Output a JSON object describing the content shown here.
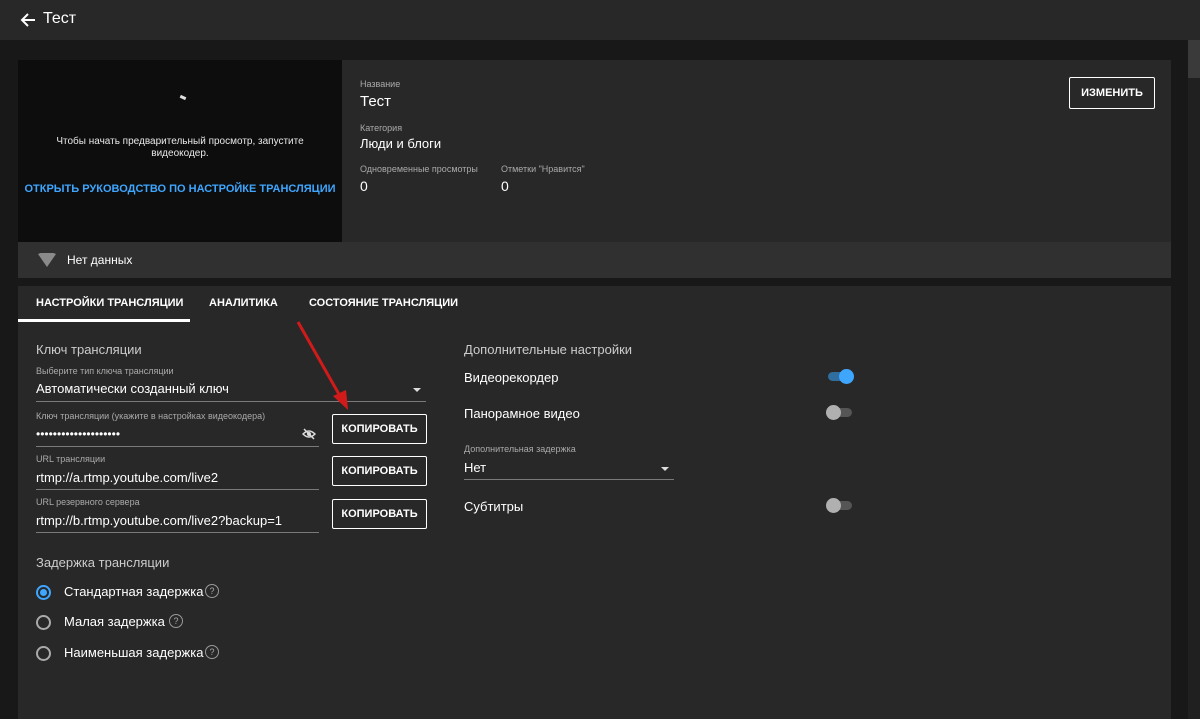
{
  "header": {
    "title": "Тест",
    "back_icon": "arrow-left-icon"
  },
  "preview": {
    "message": "Чтобы начать предварительный просмотр, запустите видеокодер.",
    "guide_link": "ОТКРЫТЬ РУКОВОДСТВО ПО НАСТРОЙКЕ ТРАНСЛЯЦИИ"
  },
  "info": {
    "title_label": "Название",
    "title_value": "Тест",
    "category_label": "Категория",
    "category_value": "Люди и блоги",
    "concurrent_label": "Одновременные просмотры",
    "concurrent_value": "0",
    "likes_label": "Отметки \"Нравится\"",
    "likes_value": "0",
    "edit_button": "ИЗМЕНИТЬ"
  },
  "status_bar": {
    "text": "Нет данных",
    "icon": "signal-icon"
  },
  "tabs": [
    {
      "label": "НАСТРОЙКИ ТРАНСЛЯЦИИ",
      "active": true
    },
    {
      "label": "АНАЛИТИКА",
      "active": false
    },
    {
      "label": "СОСТОЯНИЕ ТРАНСЛЯЦИИ",
      "active": false
    }
  ],
  "stream_key": {
    "section_title": "Ключ трансляции",
    "type_label": "Выберите тип ключа трансляции",
    "type_value": "Автоматически созданный ключ",
    "key_label": "Ключ трансляции (укажите в настройках видеокодера)",
    "key_value": "••••••••••••••••••••",
    "url_label": "URL трансляции",
    "url_value": "rtmp://a.rtmp.youtube.com/live2",
    "backup_label": "URL резервного сервера",
    "backup_value": "rtmp://b.rtmp.youtube.com/live2?backup=1",
    "copy_label": "КОПИРОВАТЬ"
  },
  "latency": {
    "section_title": "Задержка трансляции",
    "options": [
      {
        "label": "Стандартная задержка",
        "checked": true
      },
      {
        "label": "Малая задержка",
        "checked": false
      },
      {
        "label": "Наименьшая задержка",
        "checked": false
      }
    ]
  },
  "extra": {
    "section_title": "Дополнительные настройки",
    "dvr_label": "Видеорекордер",
    "dvr_on": true,
    "vr360_label": "Панорамное видео",
    "vr360_on": false,
    "delay_label": "Дополнительная задержка",
    "delay_value": "Нет",
    "captions_label": "Субтитры",
    "captions_on": false
  },
  "colors": {
    "accent": "#3ea6ff",
    "annotation_arrow": "#d11a1a"
  }
}
